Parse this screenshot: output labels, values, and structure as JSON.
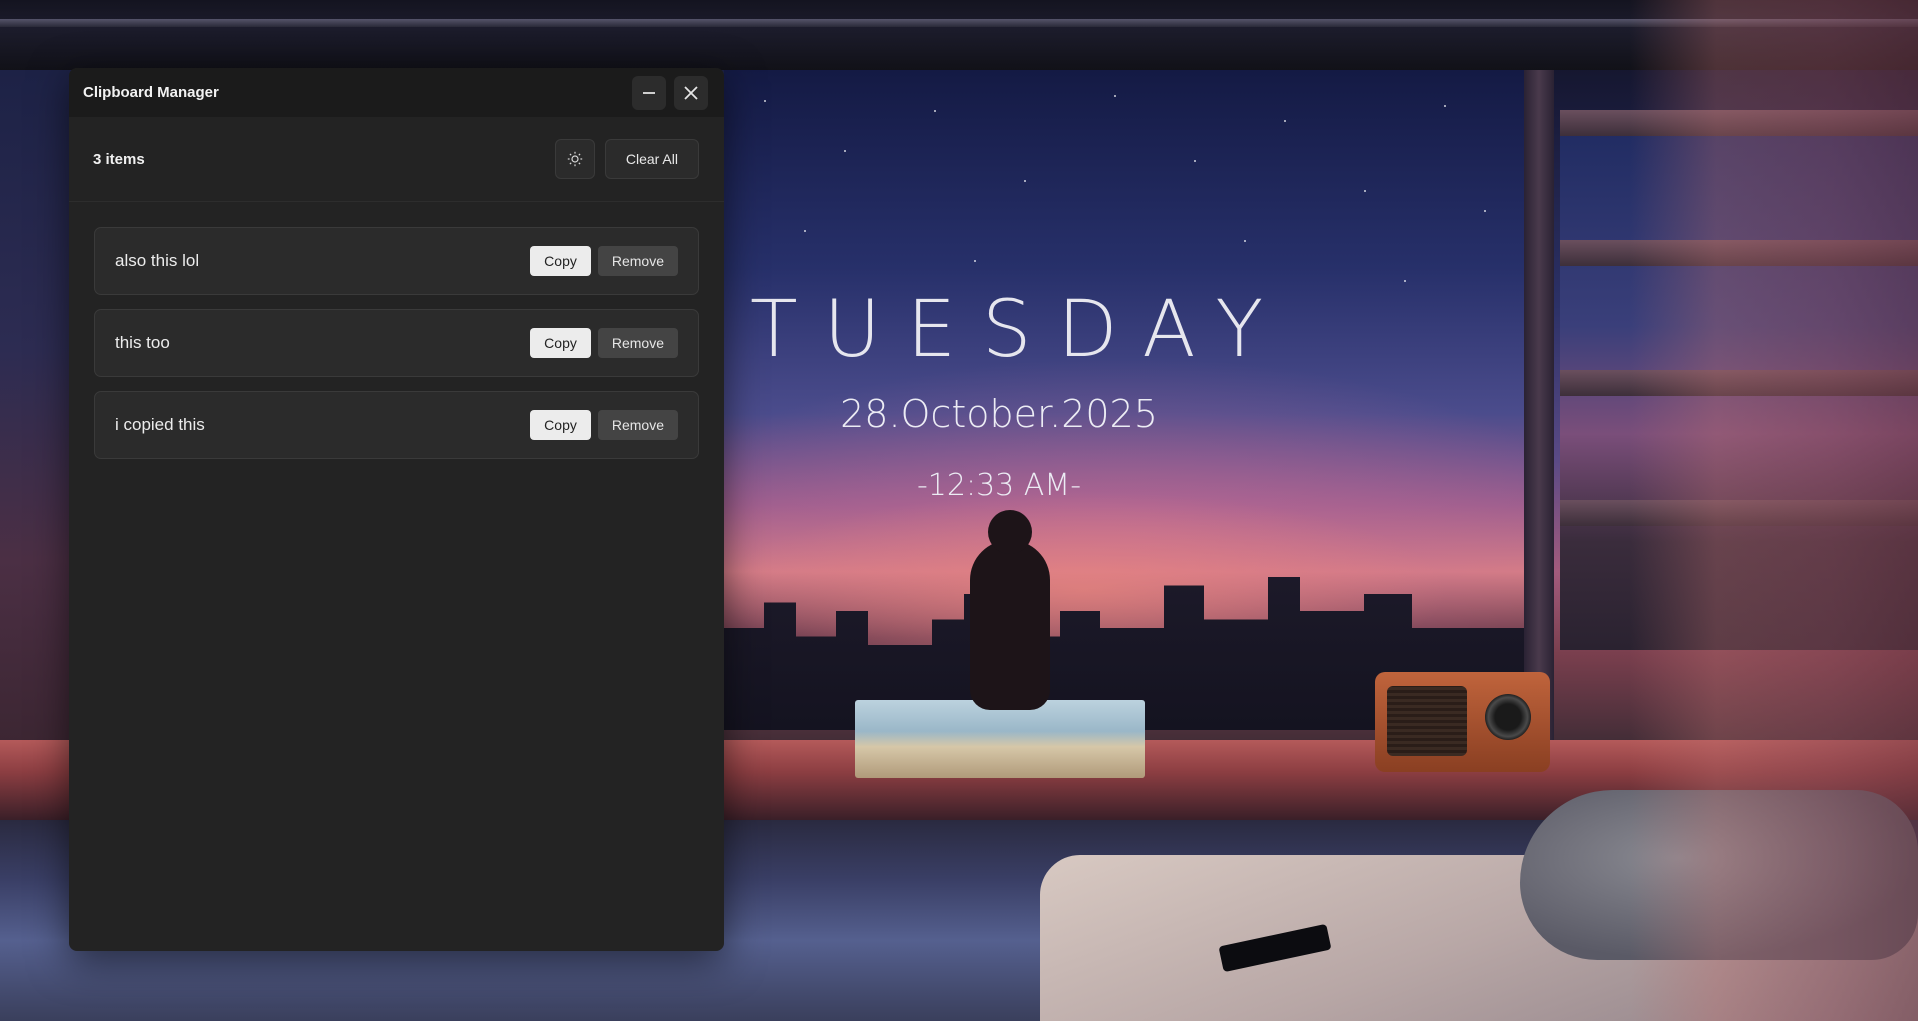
{
  "window": {
    "title": "Clipboard Manager"
  },
  "header": {
    "count_label": "3 items",
    "clear_label": "Clear All",
    "theme_icon": "sun-icon"
  },
  "items": [
    {
      "text": "also this lol",
      "copy_label": "Copy",
      "remove_label": "Remove"
    },
    {
      "text": "this too",
      "copy_label": "Copy",
      "remove_label": "Remove"
    },
    {
      "text": "i copied this",
      "copy_label": "Copy",
      "remove_label": "Remove"
    }
  ],
  "clock_widget": {
    "day": "TUESDAY",
    "date": "28.October.2025",
    "time": "-12:33 AM-"
  },
  "colors": {
    "window_bg": "#232323",
    "titlebar_bg": "#1b1b1b",
    "item_bg": "#2b2b2b",
    "copy_button_bg": "#ececec",
    "remove_button_bg": "#444444"
  }
}
